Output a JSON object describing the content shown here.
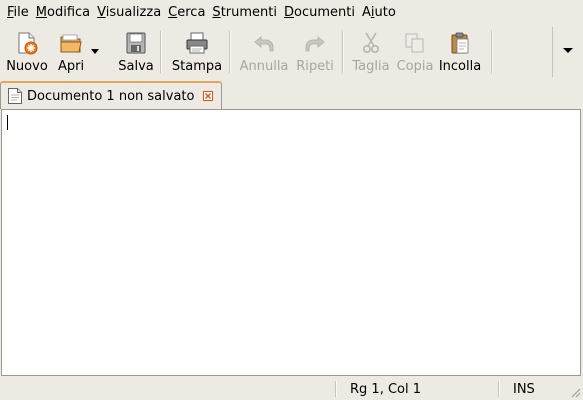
{
  "menu": [
    {
      "pre": "",
      "u": "F",
      "post": "ile"
    },
    {
      "pre": "",
      "u": "M",
      "post": "odifica"
    },
    {
      "pre": "",
      "u": "V",
      "post": "isualizza"
    },
    {
      "pre": "",
      "u": "C",
      "post": "erca"
    },
    {
      "pre": "",
      "u": "S",
      "post": "trumenti"
    },
    {
      "pre": "",
      "u": "D",
      "post": "ocumenti"
    },
    {
      "pre": "A",
      "u": "i",
      "post": "uto"
    }
  ],
  "toolbar": {
    "new": "Nuovo",
    "open": "Apri",
    "save": "Salva",
    "print": "Stampa",
    "undo": "Annulla",
    "redo": "Ripeti",
    "cut": "Taglia",
    "copy": "Copia",
    "paste": "Incolla"
  },
  "tab": {
    "label": "Documento 1 non salvato"
  },
  "editor": {
    "content": ""
  },
  "status": {
    "position": "Rg 1, Col 1",
    "mode": "INS"
  },
  "colors": {
    "tab_accent": "#e5a55a",
    "close_icon": "#d9531e",
    "disabled_text": "#a8a59f"
  }
}
